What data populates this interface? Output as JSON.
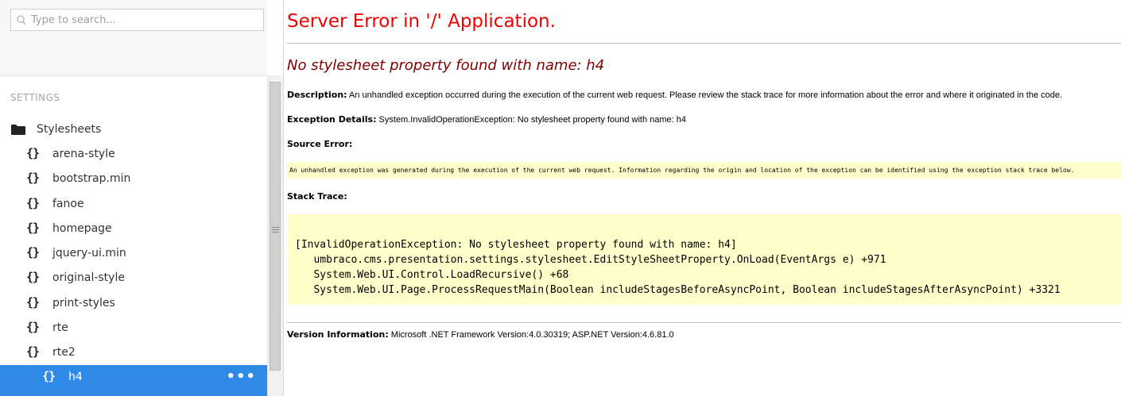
{
  "search": {
    "placeholder": "Type to search..."
  },
  "tree": {
    "section_title": "SETTINGS",
    "root": {
      "label": "Stylesheets",
      "icon": "folder-icon"
    },
    "items": [
      {
        "label": "arena-style"
      },
      {
        "label": "bootstrap.min"
      },
      {
        "label": "fanoe"
      },
      {
        "label": "homepage"
      },
      {
        "label": "jquery-ui.min"
      },
      {
        "label": "original-style"
      },
      {
        "label": "print-styles"
      },
      {
        "label": "rte"
      },
      {
        "label": "rte2"
      }
    ],
    "selected": {
      "label": "h4",
      "icon_glyph": "{}",
      "menu_glyph": "•••"
    },
    "item_icon_glyph": "{}",
    "selection_color": "#2e8ae6"
  },
  "error": {
    "title": "Server Error in '/' Application.",
    "subtitle": "No stylesheet property found with name: h4",
    "description_label": "Description:",
    "description_text": "An unhandled exception occurred during the execution of the current web request. Please review the stack trace for more information about the error and where it originated in the code.",
    "exception_label": "Exception Details:",
    "exception_text": "System.InvalidOperationException: No stylesheet property found with name: h4",
    "source_error_label": "Source Error:",
    "source_error_text": "An unhandled exception was generated during the execution of the current web request. Information regarding the origin and location of the exception can be identified using the exception stack trace below.",
    "stack_trace_label": "Stack Trace:",
    "stack_lines": [
      "[InvalidOperationException: No stylesheet property found with name: h4]",
      "   umbraco.cms.presentation.settings.stylesheet.EditStyleSheetProperty.OnLoad(EventArgs e) +971",
      "   System.Web.UI.Control.LoadRecursive() +68",
      "   System.Web.UI.Page.ProcessRequestMain(Boolean includeStagesBeforeAsyncPoint, Boolean includeStagesAfterAsyncPoint) +3321"
    ],
    "version_label": "Version Information:",
    "version_text": "Microsoft .NET Framework Version:4.0.30319; ASP.NET Version:4.6.81.0",
    "title_color": "#f00000",
    "subtitle_color": "#800000",
    "highlight_color": "#ffffcc"
  }
}
